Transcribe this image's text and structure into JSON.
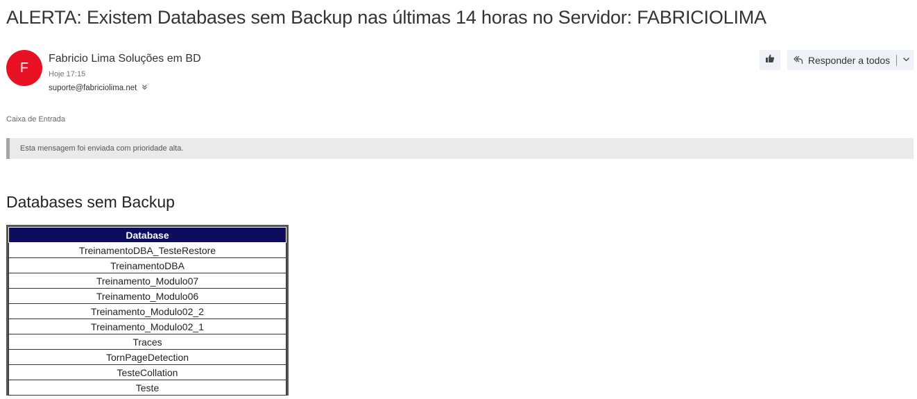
{
  "message": {
    "subject": "ALERTA: Existem Databases sem Backup nas últimas 14 horas no Servidor: FABRICIOLIMA",
    "sender": {
      "initial": "F",
      "name": "Fabricio Lima Soluções em BD",
      "avatar_color": "#e81123"
    },
    "time": "Hoje 17:15",
    "recipient": "suporte@fabriciolima.net",
    "folder": "Caixa de Entrada",
    "priority_notice": "Esta mensagem foi enviada com prioridade alta."
  },
  "actions": {
    "like_icon": "thumbs-up-icon",
    "reply_all_label": "Responder a todos",
    "reply_all_icon": "reply-all-icon",
    "dropdown_icon": "chevron-down-icon"
  },
  "body": {
    "heading": "Databases sem Backup",
    "table": {
      "header_color": "#0d0d5e",
      "columns": [
        "Database"
      ],
      "rows": [
        "TreinamentoDBA_TesteRestore",
        "TreinamentoDBA",
        "Treinamento_Modulo07",
        "Treinamento_Modulo06",
        "Treinamento_Modulo02_2",
        "Treinamento_Modulo02_1",
        "Traces",
        "TornPageDetection",
        "TesteCollation",
        "Teste"
      ]
    }
  }
}
